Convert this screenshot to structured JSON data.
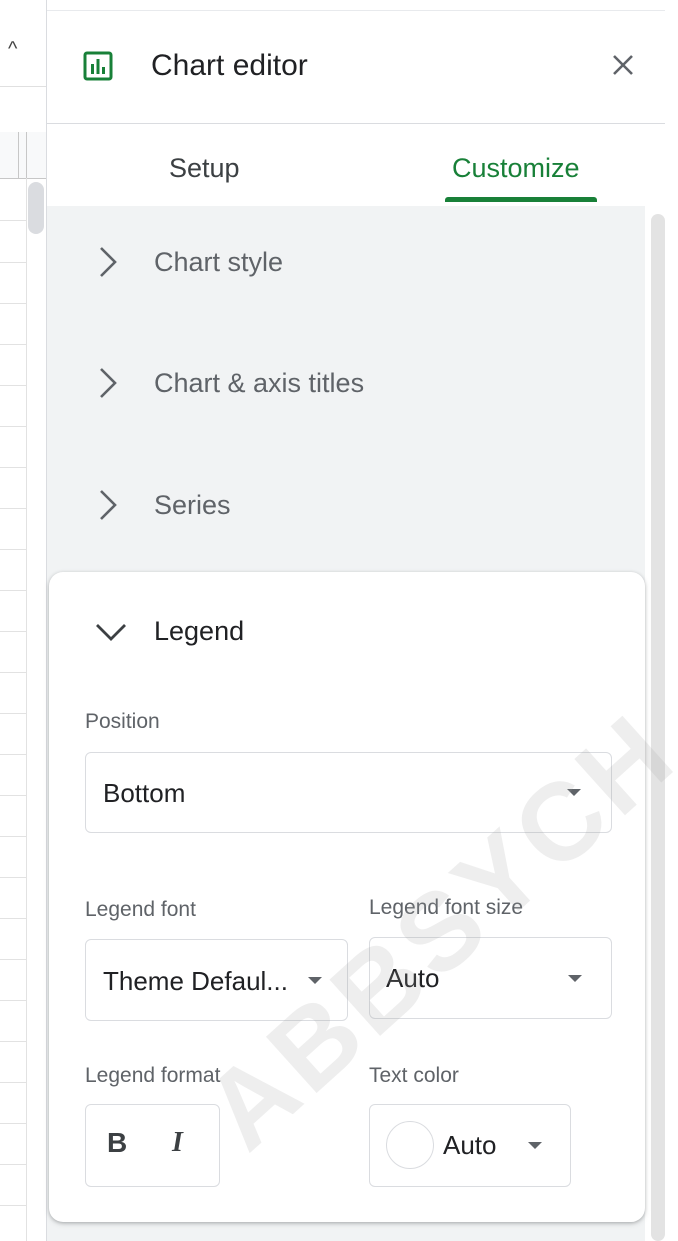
{
  "header": {
    "title": "Chart editor"
  },
  "tabs": [
    {
      "label": "Setup",
      "active": false
    },
    {
      "label": "Customize",
      "active": true
    }
  ],
  "sections": [
    {
      "label": "Chart style",
      "expanded": false
    },
    {
      "label": "Chart & axis titles",
      "expanded": false
    },
    {
      "label": "Series",
      "expanded": false
    }
  ],
  "legend": {
    "label": "Legend",
    "position_label": "Position",
    "position_value": "Bottom",
    "font_label": "Legend font",
    "font_value": "Theme Defaul...",
    "font_size_label": "Legend font size",
    "font_size_value": "Auto",
    "format_label": "Legend format",
    "bold_label": "B",
    "italic_label": "I",
    "text_color_label": "Text color",
    "text_color_value": "Auto"
  },
  "watermark": "ABBSYCH",
  "colors": {
    "accent": "#188038",
    "panel_bg": "#f1f3f4",
    "border": "#dadce0"
  }
}
